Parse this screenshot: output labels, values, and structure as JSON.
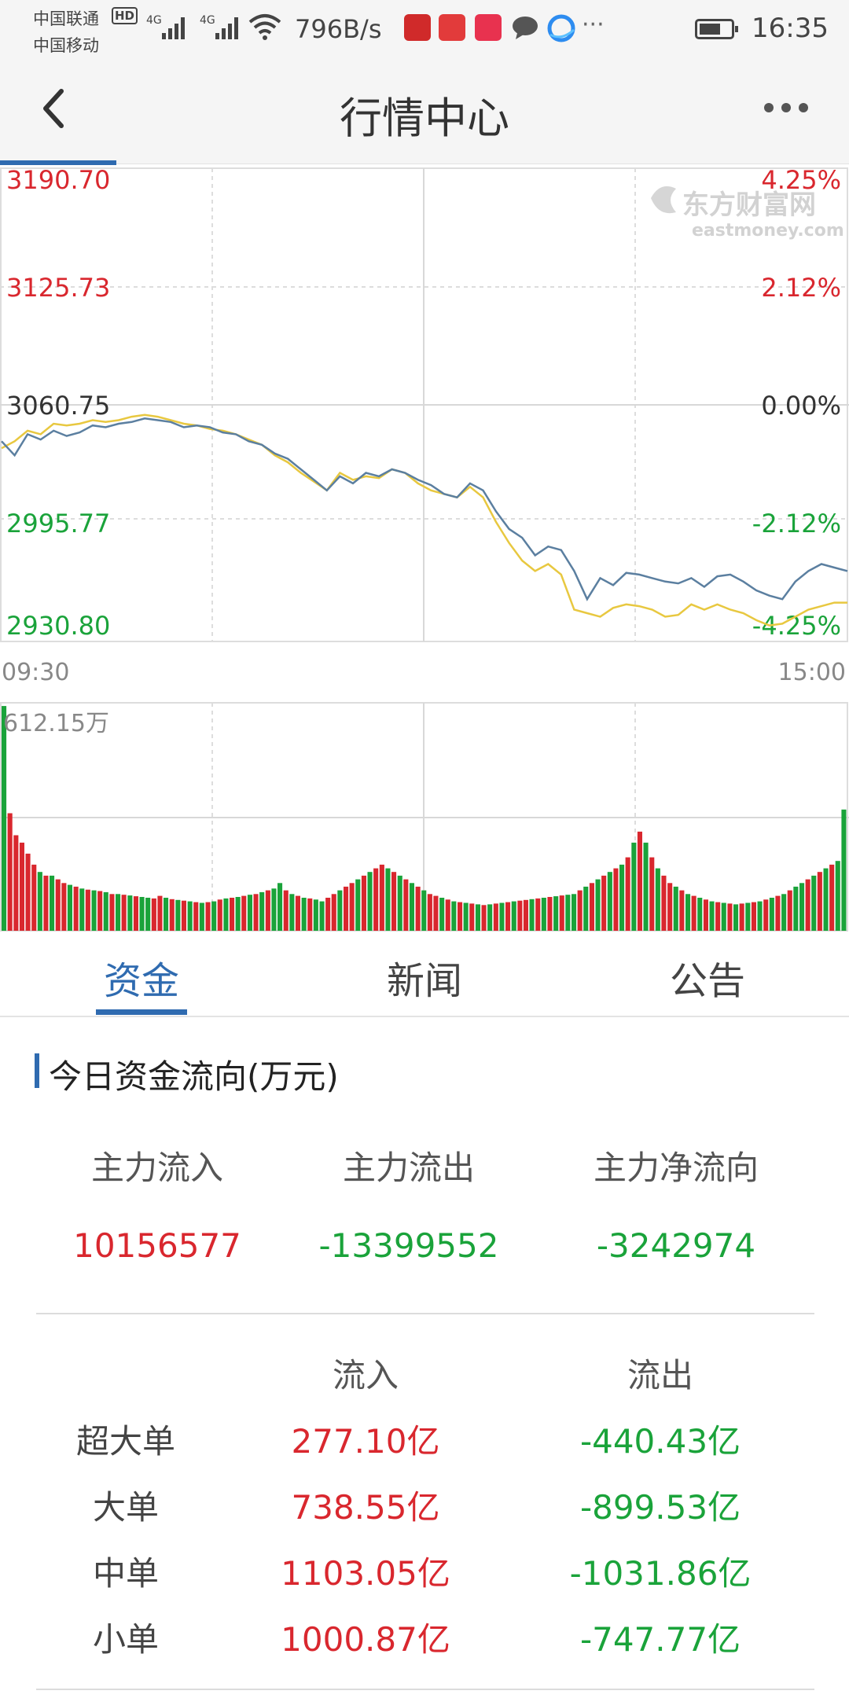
{
  "status_bar": {
    "carrier1": "中国联通",
    "carrier2": "中国移动",
    "hd": "HD",
    "net1": "4G",
    "net2": "4G",
    "speed": "796B/s",
    "time": "16:35",
    "more": "···"
  },
  "header": {
    "title": "行情中心"
  },
  "watermark": {
    "cn": "东方财富网",
    "en": "eastmoney.com"
  },
  "chart_data": {
    "type": "line",
    "price_axis_left": [
      "3190.70",
      "3125.73",
      "3060.75",
      "2995.77",
      "2930.80"
    ],
    "percent_axis_right": [
      "4.25%",
      "2.12%",
      "0.00%",
      "-2.12%",
      "-4.25%"
    ],
    "ylim": [
      2930.8,
      3190.7
    ],
    "prev_close": 3060.75,
    "x_labels": [
      "09:30",
      "15:00"
    ],
    "series": [
      {
        "values": [
          3040,
          3032,
          3044,
          3041,
          3046,
          3043,
          3045,
          3049,
          3048,
          3050,
          3051,
          3053,
          3052,
          3051,
          3048,
          3049,
          3048,
          3045,
          3044,
          3040,
          3038,
          3033,
          3030,
          3024,
          3018,
          3012,
          3020,
          3016,
          3022,
          3020,
          3024,
          3022,
          3018,
          3015,
          3010,
          3008,
          3016,
          3012,
          3000,
          2990,
          2985,
          2975,
          2980,
          2978,
          2966,
          2950,
          2962,
          2958,
          2965,
          2964,
          2962,
          2960,
          2959,
          2962,
          2957,
          2963,
          2964,
          2960,
          2955,
          2952,
          2950,
          2960,
          2966,
          2970,
          2968,
          2966
        ]
      },
      {
        "values": [
          3036,
          3040,
          3046,
          3044,
          3050,
          3049,
          3050,
          3052,
          3051,
          3052,
          3054,
          3055,
          3054,
          3052,
          3050,
          3049,
          3047,
          3046,
          3044,
          3041,
          3038,
          3032,
          3028,
          3022,
          3017,
          3012,
          3022,
          3018,
          3020,
          3019,
          3024,
          3022,
          3016,
          3012,
          3010,
          3008,
          3014,
          3008,
          2994,
          2982,
          2972,
          2966,
          2970,
          2964,
          2944,
          2942,
          2940,
          2945,
          2947,
          2946,
          2944,
          2940,
          2941,
          2947,
          2944,
          2947,
          2944,
          2942,
          2938,
          2935,
          2936,
          2940,
          2944,
          2946,
          2948,
          2948
        ]
      }
    ],
    "volume": {
      "max_label": "612.15万",
      "max": 612.15,
      "bars": [
        {
          "v": 612,
          "c": "g"
        },
        {
          "v": 320,
          "c": "r"
        },
        {
          "v": 260,
          "c": "r"
        },
        {
          "v": 240,
          "c": "r"
        },
        {
          "v": 210,
          "c": "r"
        },
        {
          "v": 180,
          "c": "r"
        },
        {
          "v": 160,
          "c": "g"
        },
        {
          "v": 150,
          "c": "r"
        },
        {
          "v": 150,
          "c": "g"
        },
        {
          "v": 140,
          "c": "r"
        },
        {
          "v": 130,
          "c": "r"
        },
        {
          "v": 125,
          "c": "g"
        },
        {
          "v": 120,
          "c": "r"
        },
        {
          "v": 115,
          "c": "g"
        },
        {
          "v": 112,
          "c": "r"
        },
        {
          "v": 110,
          "c": "g"
        },
        {
          "v": 108,
          "c": "r"
        },
        {
          "v": 105,
          "c": "g"
        },
        {
          "v": 100,
          "c": "r"
        },
        {
          "v": 100,
          "c": "g"
        },
        {
          "v": 98,
          "c": "r"
        },
        {
          "v": 96,
          "c": "g"
        },
        {
          "v": 94,
          "c": "r"
        },
        {
          "v": 92,
          "c": "g"
        },
        {
          "v": 90,
          "c": "g"
        },
        {
          "v": 88,
          "c": "r"
        },
        {
          "v": 95,
          "c": "r"
        },
        {
          "v": 90,
          "c": "g"
        },
        {
          "v": 86,
          "c": "r"
        },
        {
          "v": 84,
          "c": "g"
        },
        {
          "v": 82,
          "c": "r"
        },
        {
          "v": 80,
          "c": "g"
        },
        {
          "v": 78,
          "c": "r"
        },
        {
          "v": 76,
          "c": "g"
        },
        {
          "v": 78,
          "c": "r"
        },
        {
          "v": 80,
          "c": "g"
        },
        {
          "v": 85,
          "c": "r"
        },
        {
          "v": 88,
          "c": "g"
        },
        {
          "v": 90,
          "c": "r"
        },
        {
          "v": 92,
          "c": "g"
        },
        {
          "v": 95,
          "c": "r"
        },
        {
          "v": 98,
          "c": "g"
        },
        {
          "v": 100,
          "c": "r"
        },
        {
          "v": 105,
          "c": "g"
        },
        {
          "v": 110,
          "c": "r"
        },
        {
          "v": 115,
          "c": "g"
        },
        {
          "v": 130,
          "c": "g"
        },
        {
          "v": 110,
          "c": "r"
        },
        {
          "v": 100,
          "c": "g"
        },
        {
          "v": 95,
          "c": "r"
        },
        {
          "v": 90,
          "c": "g"
        },
        {
          "v": 88,
          "c": "r"
        },
        {
          "v": 85,
          "c": "g"
        },
        {
          "v": 80,
          "c": "g"
        },
        {
          "v": 90,
          "c": "r"
        },
        {
          "v": 100,
          "c": "r"
        },
        {
          "v": 110,
          "c": "g"
        },
        {
          "v": 120,
          "c": "r"
        },
        {
          "v": 130,
          "c": "r"
        },
        {
          "v": 140,
          "c": "g"
        },
        {
          "v": 150,
          "c": "r"
        },
        {
          "v": 160,
          "c": "g"
        },
        {
          "v": 170,
          "c": "r"
        },
        {
          "v": 180,
          "c": "r"
        },
        {
          "v": 170,
          "c": "g"
        },
        {
          "v": 160,
          "c": "r"
        },
        {
          "v": 150,
          "c": "g"
        },
        {
          "v": 140,
          "c": "r"
        },
        {
          "v": 130,
          "c": "g"
        },
        {
          "v": 120,
          "c": "r"
        },
        {
          "v": 110,
          "c": "g"
        },
        {
          "v": 100,
          "c": "r"
        },
        {
          "v": 95,
          "c": "r"
        },
        {
          "v": 90,
          "c": "g"
        },
        {
          "v": 85,
          "c": "r"
        },
        {
          "v": 80,
          "c": "g"
        },
        {
          "v": 78,
          "c": "r"
        },
        {
          "v": 76,
          "c": "g"
        },
        {
          "v": 74,
          "c": "r"
        },
        {
          "v": 72,
          "c": "g"
        },
        {
          "v": 70,
          "c": "r"
        },
        {
          "v": 72,
          "c": "g"
        },
        {
          "v": 74,
          "c": "r"
        },
        {
          "v": 76,
          "c": "g"
        },
        {
          "v": 78,
          "c": "r"
        },
        {
          "v": 80,
          "c": "g"
        },
        {
          "v": 82,
          "c": "r"
        },
        {
          "v": 84,
          "c": "r"
        },
        {
          "v": 86,
          "c": "g"
        },
        {
          "v": 88,
          "c": "r"
        },
        {
          "v": 90,
          "c": "g"
        },
        {
          "v": 92,
          "c": "r"
        },
        {
          "v": 94,
          "c": "g"
        },
        {
          "v": 96,
          "c": "r"
        },
        {
          "v": 98,
          "c": "g"
        },
        {
          "v": 100,
          "c": "g"
        },
        {
          "v": 110,
          "c": "r"
        },
        {
          "v": 120,
          "c": "g"
        },
        {
          "v": 130,
          "c": "r"
        },
        {
          "v": 140,
          "c": "g"
        },
        {
          "v": 150,
          "c": "r"
        },
        {
          "v": 160,
          "c": "g"
        },
        {
          "v": 170,
          "c": "r"
        },
        {
          "v": 180,
          "c": "g"
        },
        {
          "v": 200,
          "c": "r"
        },
        {
          "v": 240,
          "c": "g"
        },
        {
          "v": 270,
          "c": "r"
        },
        {
          "v": 240,
          "c": "g"
        },
        {
          "v": 200,
          "c": "r"
        },
        {
          "v": 170,
          "c": "g"
        },
        {
          "v": 150,
          "c": "r"
        },
        {
          "v": 130,
          "c": "r"
        },
        {
          "v": 120,
          "c": "g"
        },
        {
          "v": 110,
          "c": "r"
        },
        {
          "v": 100,
          "c": "g"
        },
        {
          "v": 95,
          "c": "r"
        },
        {
          "v": 90,
          "c": "g"
        },
        {
          "v": 85,
          "c": "r"
        },
        {
          "v": 80,
          "c": "g"
        },
        {
          "v": 78,
          "c": "r"
        },
        {
          "v": 76,
          "c": "g"
        },
        {
          "v": 74,
          "c": "r"
        },
        {
          "v": 72,
          "c": "g"
        },
        {
          "v": 74,
          "c": "r"
        },
        {
          "v": 76,
          "c": "g"
        },
        {
          "v": 78,
          "c": "r"
        },
        {
          "v": 80,
          "c": "g"
        },
        {
          "v": 85,
          "c": "r"
        },
        {
          "v": 90,
          "c": "g"
        },
        {
          "v": 95,
          "c": "r"
        },
        {
          "v": 100,
          "c": "g"
        },
        {
          "v": 110,
          "c": "r"
        },
        {
          "v": 120,
          "c": "g"
        },
        {
          "v": 130,
          "c": "g"
        },
        {
          "v": 140,
          "c": "r"
        },
        {
          "v": 150,
          "c": "g"
        },
        {
          "v": 160,
          "c": "r"
        },
        {
          "v": 170,
          "c": "g"
        },
        {
          "v": 180,
          "c": "r"
        },
        {
          "v": 190,
          "c": "g"
        },
        {
          "v": 330,
          "c": "g"
        }
      ]
    }
  },
  "tabs": [
    {
      "label": "资金",
      "active": true
    },
    {
      "label": "新闻",
      "active": false
    },
    {
      "label": "公告",
      "active": false
    }
  ],
  "fund_flow": {
    "title": "今日资金流向(万元)",
    "summary": [
      {
        "label": "主力流入",
        "value": "10156577",
        "color": "red"
      },
      {
        "label": "主力流出",
        "value": "-13399552",
        "color": "green"
      },
      {
        "label": "主力净流向",
        "value": "-3242974",
        "color": "green"
      }
    ],
    "table_header": {
      "in": "流入",
      "out": "流出"
    },
    "rows": [
      {
        "label": "超大单",
        "in": "277.10亿",
        "out": "-440.43亿"
      },
      {
        "label": "大单",
        "in": "738.55亿",
        "out": "-899.53亿"
      },
      {
        "label": "中单",
        "in": "1103.05亿",
        "out": "-1031.86亿"
      },
      {
        "label": "小单",
        "in": "1000.87亿",
        "out": "-747.77亿"
      }
    ]
  },
  "colors": {
    "accent": "#2f6bb0",
    "up": "#d9272e",
    "down": "#1aa33a",
    "price_line": "#5b7fa0",
    "avg_line": "#e8c840"
  }
}
